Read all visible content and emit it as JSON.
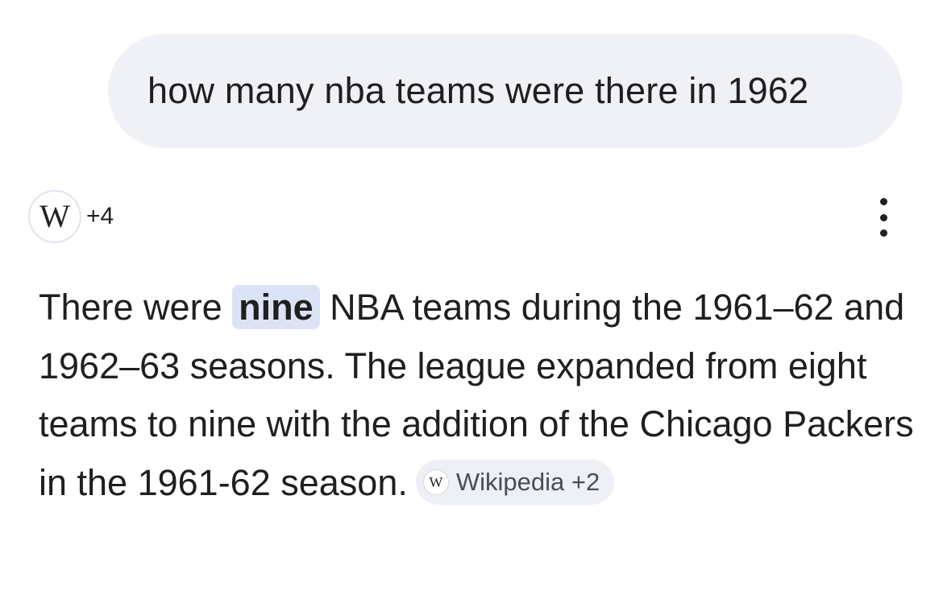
{
  "query": {
    "text": "how many nba teams were there in 1962"
  },
  "sources": {
    "icon_glyph": "W",
    "count": "+4",
    "icon": "wikipedia-icon"
  },
  "menu": {
    "icon": "more-vert-icon"
  },
  "answer": {
    "part1": "There were ",
    "highlight": "nine",
    "part2": " NBA teams during the 1961–62 and 1962–63 seasons. The league expanded from eight teams to nine with the addition of the Chicago Packers in the 1961-62 season.",
    "chip_icon_glyph": "W",
    "chip_label": "Wikipedia +2"
  },
  "colors": {
    "bubble_bg": "#f0f1f6",
    "highlight_bg": "#dde3f7",
    "chip_bg": "#eef0f6",
    "text": "#1f1f1f"
  }
}
